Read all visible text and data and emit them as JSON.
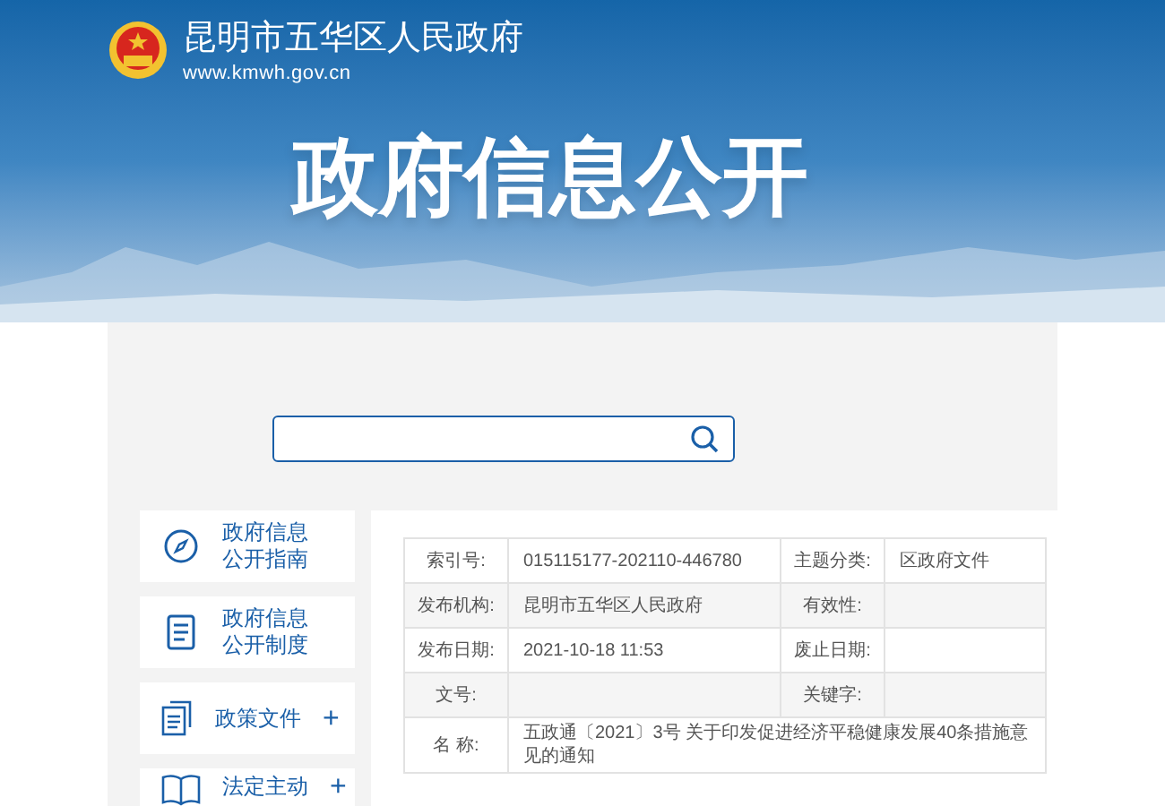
{
  "header": {
    "site_name": "昆明市五华区人民政府",
    "url": "www.kmwh.gov.cn",
    "banner_title": "政府信息公开"
  },
  "sidebar": {
    "items": [
      {
        "lines": [
          "政府信息",
          "公开指南"
        ],
        "expandable": false
      },
      {
        "lines": [
          "政府信息",
          "公开制度"
        ],
        "expandable": false
      },
      {
        "lines": [
          "政策文件"
        ],
        "expandable": true,
        "toggle": "+"
      },
      {
        "lines": [
          "法定主动"
        ],
        "expandable": true,
        "toggle": "+"
      }
    ]
  },
  "info_table": {
    "rows": [
      {
        "cells": [
          {
            "label": "索引号:",
            "value": "015115177-202110-446780"
          },
          {
            "label": "主题分类:",
            "value": "区政府文件"
          }
        ]
      },
      {
        "cells": [
          {
            "label": "发布机构:",
            "value": "昆明市五华区人民政府"
          },
          {
            "label": "有效性:"
          }
        ]
      },
      {
        "cells": [
          {
            "label": "发布日期:",
            "value": "2021-10-18 11:53"
          },
          {
            "label": "废止日期:"
          }
        ]
      },
      {
        "cells": [
          {
            "label": "文号:"
          },
          {
            "label": "关键字:"
          }
        ]
      },
      {
        "cells": [
          {
            "label": "名 称:",
            "value": "五政通〔2021〕3号 关于印发促进经济平稳健康发展40条措施意见的通知"
          }
        ]
      }
    ]
  }
}
